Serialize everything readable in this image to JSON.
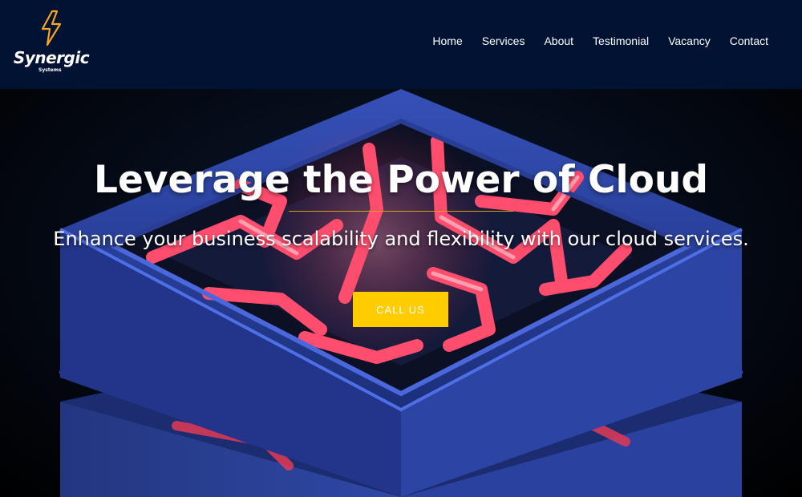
{
  "brand": {
    "name": "Synergic",
    "tagline": "Systems",
    "accent_color": "#f5a623"
  },
  "nav": {
    "items": [
      {
        "label": "Home"
      },
      {
        "label": "Services"
      },
      {
        "label": "About"
      },
      {
        "label": "Testimonial"
      },
      {
        "label": "Vacancy"
      },
      {
        "label": "Contact"
      }
    ]
  },
  "hero": {
    "title": "Leverage the Power of Cloud",
    "subtitle": "Enhance your business scalability and flexibility with our cloud services.",
    "cta_label": "CALL US",
    "cta_color": "#ffcc00",
    "divider_color": "#d4a21a",
    "background_art": "3d-server-stack-illustration"
  },
  "colors": {
    "navbar_bg": "#021233",
    "hero_blue": "#2a3f9e",
    "hero_red": "#ff4d6d"
  }
}
